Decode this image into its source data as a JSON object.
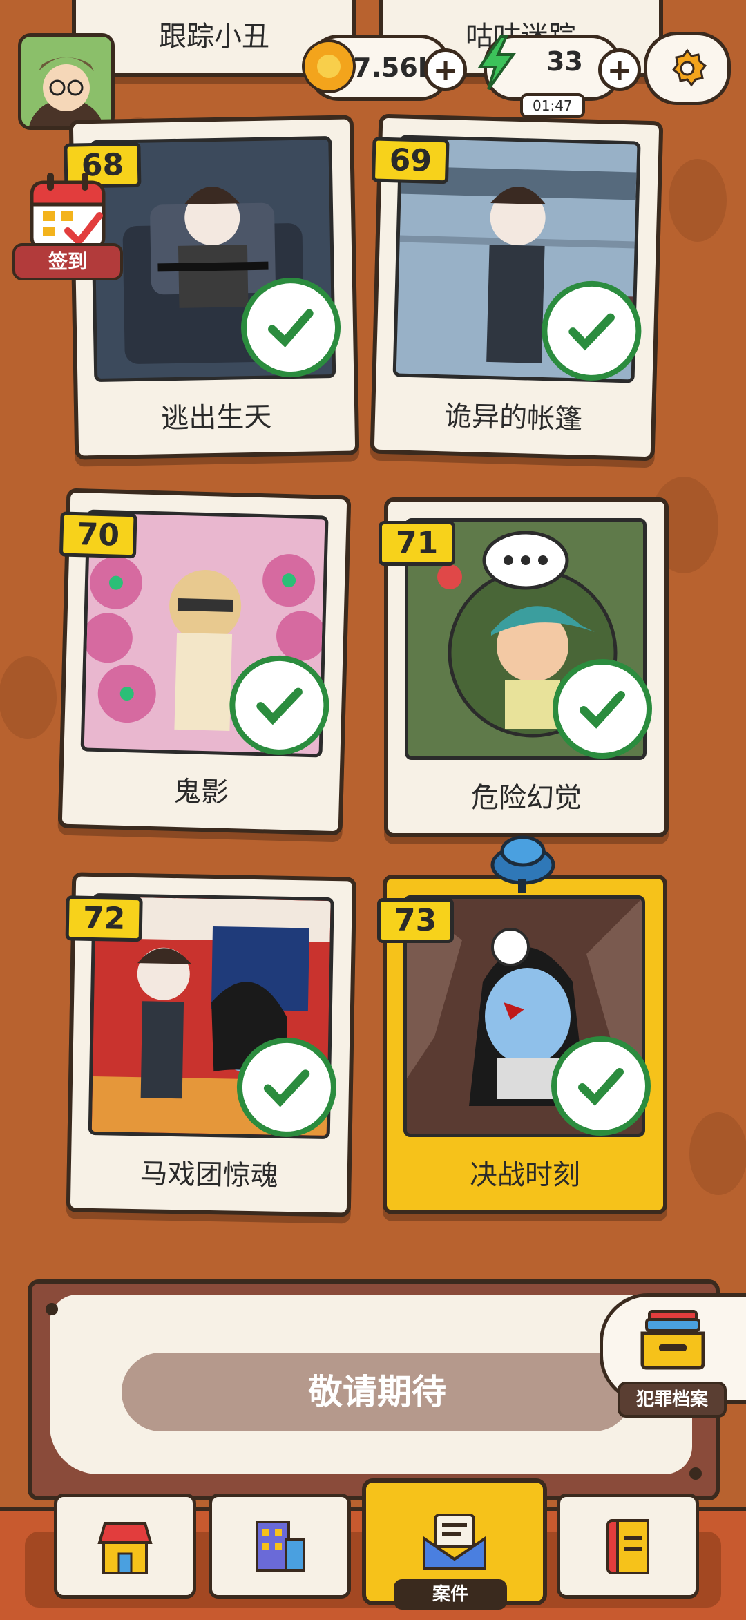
{
  "top_cards": [
    {
      "title": "跟踪小丑"
    },
    {
      "title": "咕咕迷踪"
    }
  ],
  "currency": {
    "coins": "7.56K",
    "energy": "33",
    "energy_timer": "01:47"
  },
  "checkin": {
    "label": "签到"
  },
  "levels": [
    {
      "number": "68",
      "title": "逃出生天",
      "completed": true
    },
    {
      "number": "69",
      "title": "诡异的帐篷",
      "completed": true
    },
    {
      "number": "70",
      "title": "鬼影",
      "completed": true
    },
    {
      "number": "71",
      "title": "危险幻觉",
      "completed": true
    },
    {
      "number": "72",
      "title": "马戏团惊魂",
      "completed": true
    },
    {
      "number": "73",
      "title": "决战时刻",
      "completed": true
    }
  ],
  "coming_soon": {
    "label": "敬请期待"
  },
  "archive": {
    "label": "犯罪档案"
  },
  "nav": {
    "active_label": "案件",
    "items": [
      "shop-icon",
      "building-icon",
      "case-mail-icon",
      "book-icon"
    ]
  },
  "colors": {
    "background": "#b8622f",
    "accent": "#f6c21a",
    "check": "#2b8c3e",
    "label_bg": "#8a4b3a"
  }
}
